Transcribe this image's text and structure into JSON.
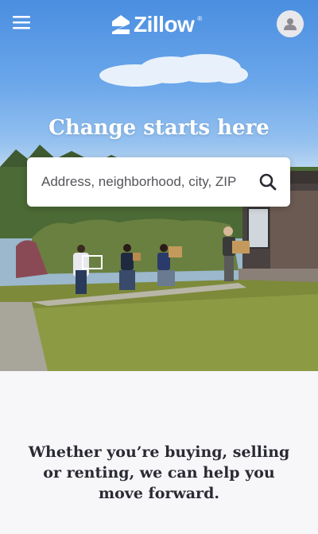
{
  "header": {
    "menu_icon": "hamburger-menu-icon",
    "logo_text": "Zillow",
    "logo_reg": "®",
    "avatar_icon": "user-avatar-icon"
  },
  "hero": {
    "headline": "Change starts here",
    "search": {
      "placeholder": "Address, neighborhood, city, ZIP",
      "icon": "search-icon"
    }
  },
  "main": {
    "tagline": "Whether you’re buying, selling or renting, we can help you move forward."
  },
  "colors": {
    "brand_white": "#ffffff",
    "text_dark": "#2a2a33",
    "sky_blue": "#4a8ee0",
    "page_bg": "#f7f7fa"
  }
}
